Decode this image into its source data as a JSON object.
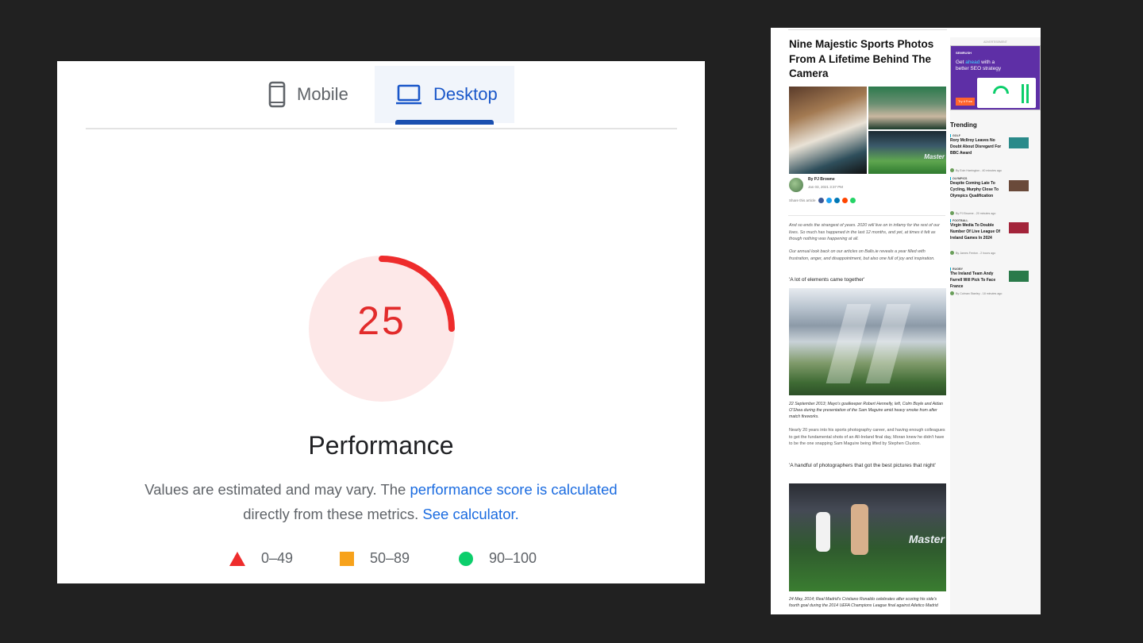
{
  "pagespeed": {
    "tabs": [
      {
        "label": "Mobile",
        "icon": "phone-icon",
        "selected": false
      },
      {
        "label": "Desktop",
        "icon": "laptop-icon",
        "selected": true
      }
    ],
    "score": "25",
    "score_fraction": 0.25,
    "score_color": "#e22b2b",
    "category": "Performance",
    "description": {
      "text_before": "Values are estimated and may vary. The ",
      "link1": "performance score is calculated",
      "text_middle": " directly from these metrics. ",
      "link2": "See calculator."
    },
    "legend": [
      {
        "range": "0–49",
        "shape": "triangle",
        "color": "#ee2c2c"
      },
      {
        "range": "50–89",
        "shape": "square",
        "color": "#f7a21b"
      },
      {
        "range": "90–100",
        "shape": "circle",
        "color": "#0cce6b"
      }
    ]
  },
  "article": {
    "title": "Nine Majestic Sports Photos From A Lifetime Behind The Camera",
    "hero_overlay_text": "Master",
    "author": "By PJ Browne",
    "date": "Jan 03, 2021 3:37 PM",
    "share_label": "Share this article",
    "share_colors": [
      "#3b5998",
      "#1da1f2",
      "#0077b5",
      "#ff4500",
      "#25d366"
    ],
    "intro1": "And so ends the strangest of years. 2020 will live on in infamy for the rest of our lives. So much has happened in the last 12 months, and yet, at times it felt as though nothing was happening at all.",
    "intro2": "Our annual look back on our articles on Balls.ie reveals a year filled with frustration, anger, and disappointment, but also one full of joy and inspiration.",
    "section1_head": "'A lot of elements came together'",
    "caption1": "22 September 2013; Mayo's goalkeeper Robert Hennelly, left, Colm Boyle and Aidan O'Shea during the presentation of the Sam Maguire amid heavy smoke from after match fireworks.",
    "body1": "Nearly 20 years into his sports photography career, and having enough colleagues to get the fundamental shots of an All-Ireland final day, Moran knew he didn't have to be the one snapping Sam Maguire being lifted by Stephen Cluxton.",
    "section2_head": "'A handful of photographers that got the best pictures that night'",
    "photo2_overlay": "Master",
    "caption2": "24 May, 2014; Real Madrid's Cristiano Ronaldo celebrates after scoring his side's fourth goal during the 2014 UEFA Champions League final against Atletico Madrid"
  },
  "sidebar": {
    "ad_label": "ADVERTISEMENT",
    "ad_brand": "SEMRUSH",
    "ad_head_plain1": "Get ",
    "ad_head_accent": "ahead",
    "ad_head_plain2": " with a better SEO strategy",
    "ad_cta": "Try it Free",
    "trending_title": "Trending",
    "items": [
      {
        "category": "GOLF",
        "headline": "Rory McIlroy Leaves No Doubt About Disregard For BBC Award",
        "meta": "By Eoin Harrington - 40 minutes ago",
        "thumb_color": "#2a8a8a"
      },
      {
        "category": "OLYMPICS",
        "headline": "Despite Coming Late To Cycling, Murphy Close To Olympics Qualification",
        "meta": "By PJ Browne - 20 minutes ago",
        "thumb_color": "#6a4a3a"
      },
      {
        "category": "FOOTBALL",
        "headline": "Virgin Media To Double Number Of Live League Of Ireland Games In 2024",
        "meta": "By James Fenton - 2 hours ago",
        "thumb_color": "#a3243a"
      },
      {
        "category": "RUGBY",
        "headline": "The Ireland Team Andy Farrell Will Pick To Face France",
        "meta": "By Colman Stanley - 18 minutes ago",
        "thumb_color": "#2a7a4a"
      }
    ]
  }
}
